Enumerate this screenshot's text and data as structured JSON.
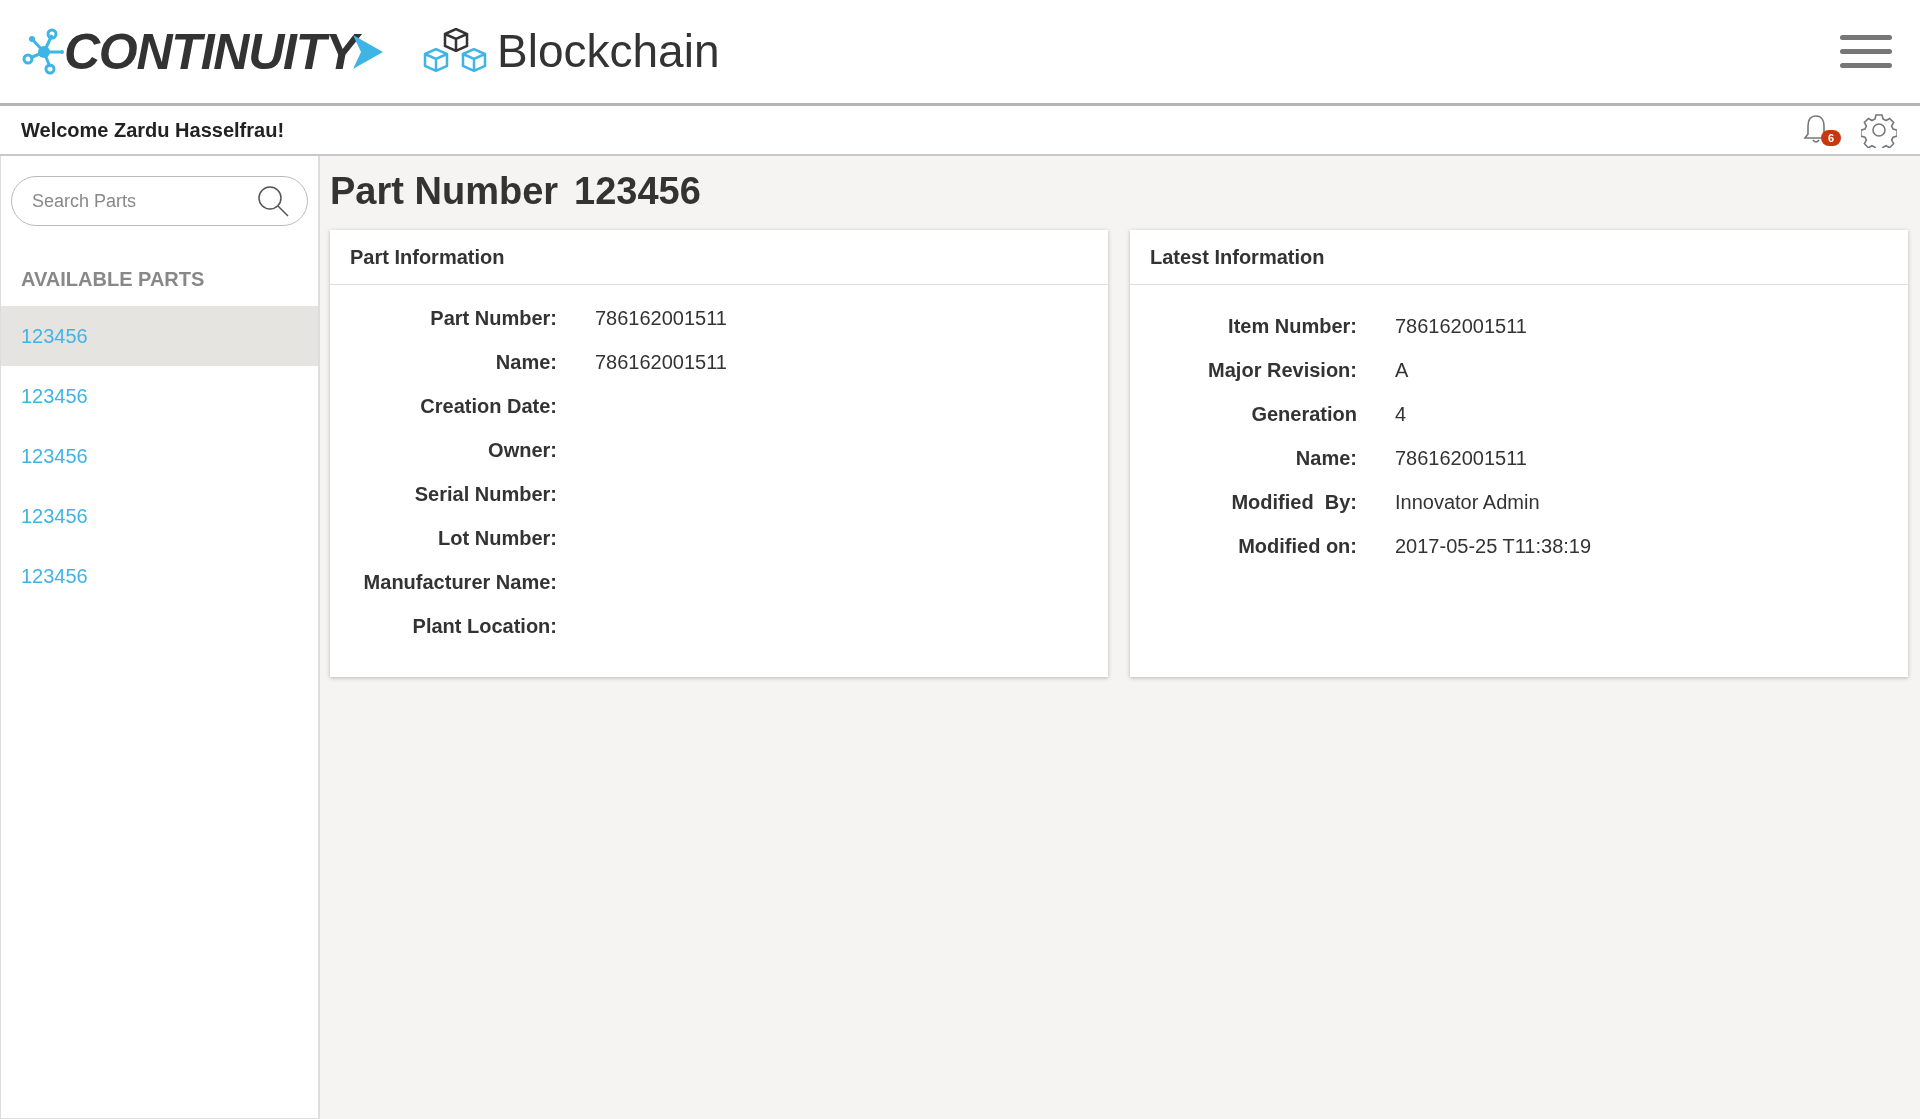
{
  "header": {
    "logo_text": "CONTINUITY",
    "product": "Blockchain"
  },
  "welcome_bar": {
    "greeting": "Welcome Zardu Hasselfrau!",
    "notification_count": "6"
  },
  "sidebar": {
    "search": {
      "placeholder": "Search Parts"
    },
    "heading": "AVAILABLE PARTS",
    "items": [
      {
        "label": "123456",
        "selected": true
      },
      {
        "label": "123456",
        "selected": false
      },
      {
        "label": "123456",
        "selected": false
      },
      {
        "label": "123456",
        "selected": false
      },
      {
        "label": "123456",
        "selected": false
      }
    ]
  },
  "page_title": {
    "label": "Part Number",
    "value": "123456"
  },
  "cards": [
    {
      "title": "Part Information",
      "fields": [
        {
          "label": "Part Number:",
          "value": "786162001511"
        },
        {
          "label": "Name:",
          "value": "786162001511"
        },
        {
          "label": "Creation Date:"
        },
        {
          "label": "Owner:"
        },
        {
          "label": "Serial Number:"
        },
        {
          "label": "Lot Number:"
        },
        {
          "label": "Manufacturer Name:"
        },
        {
          "label": "Plant Location:"
        }
      ]
    },
    {
      "title": "Latest Information",
      "fields": [
        {
          "label": "Item Number:",
          "value": "786162001511"
        },
        {
          "label": "Major Revision:",
          "value": "A"
        },
        {
          "label": "Generation",
          "value": "4"
        },
        {
          "label": "Name:",
          "value": "786162001511"
        },
        {
          "label": "Modified  By:",
          "value": "Innovator Admin"
        },
        {
          "label": "Modified on:",
          "value": "2017-05-25 T11:38:19"
        }
      ]
    }
  ]
}
